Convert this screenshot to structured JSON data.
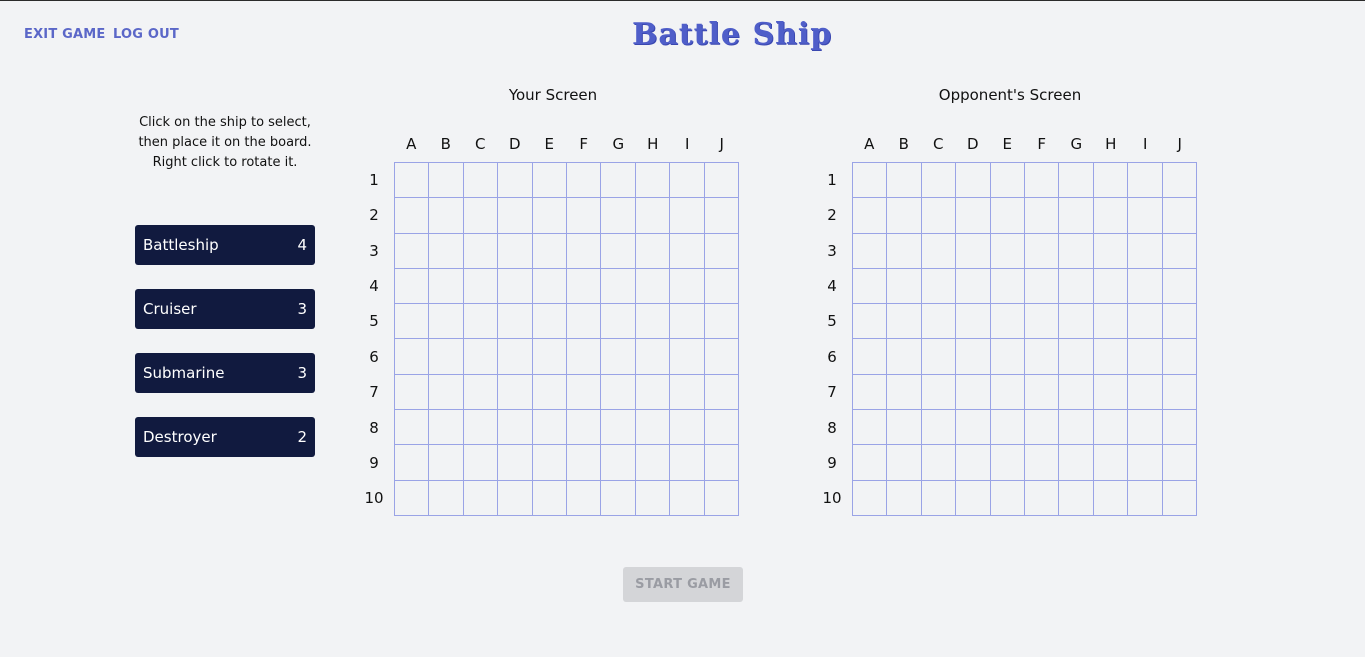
{
  "nav": {
    "exit_label": "EXIT GAME",
    "logout_label": "LOG OUT"
  },
  "logo": {
    "text": "Battle Ship"
  },
  "instructions": {
    "line1": "Click on the ship to select,",
    "line2": "then place it on the board.",
    "line3": "Right click to rotate it."
  },
  "ships": [
    {
      "name": "Battleship",
      "size": "4"
    },
    {
      "name": "Cruiser",
      "size": "3"
    },
    {
      "name": "Submarine",
      "size": "3"
    },
    {
      "name": "Destroyer",
      "size": "2"
    }
  ],
  "boards": {
    "player_title": "Your Screen",
    "opponent_title": "Opponent's Screen",
    "columns": [
      "A",
      "B",
      "C",
      "D",
      "E",
      "F",
      "G",
      "H",
      "I",
      "J"
    ],
    "rows": [
      "1",
      "2",
      "3",
      "4",
      "5",
      "6",
      "7",
      "8",
      "9",
      "10"
    ]
  },
  "actions": {
    "start_label": "START GAME",
    "start_enabled": false
  },
  "colors": {
    "accent": "#5b67c8",
    "ship_button": "#111a3f",
    "grid_line": "#9aa3e6",
    "disabled_button": "#d4d5d8"
  }
}
